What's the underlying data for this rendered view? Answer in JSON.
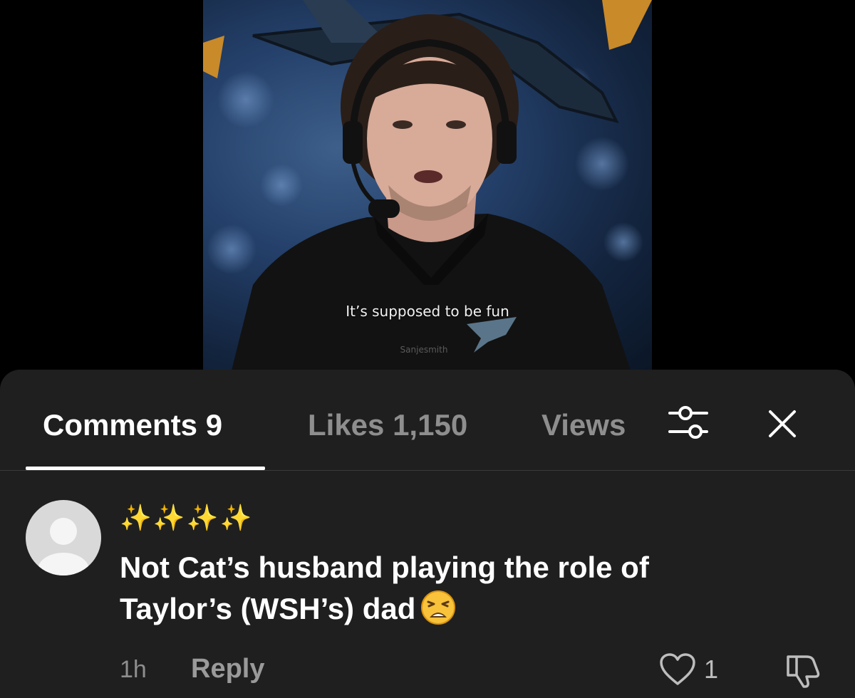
{
  "video": {
    "subtitle": "It’s supposed to be fun",
    "watermark": "Sanjesmith"
  },
  "tabs": {
    "comments_label": "Comments 9",
    "likes_label": "Likes 1,150",
    "views_label": "Views"
  },
  "icons": {
    "filter": "sliders-icon",
    "close": "close-icon",
    "like": "heart-outline-icon",
    "dislike": "thumbs-down-icon"
  },
  "comment": {
    "username": "✨✨✨✨",
    "text": "Not Cat’s husband playing the role of Taylor’s (WSH’s) dad",
    "emoji": "weary-face",
    "time": "1h",
    "reply_label": "Reply",
    "like_count": "1"
  },
  "colors": {
    "sheet_background": "#1f1f1f",
    "active_tab": "#ffffff",
    "inactive_tab": "#8e8e8e"
  }
}
